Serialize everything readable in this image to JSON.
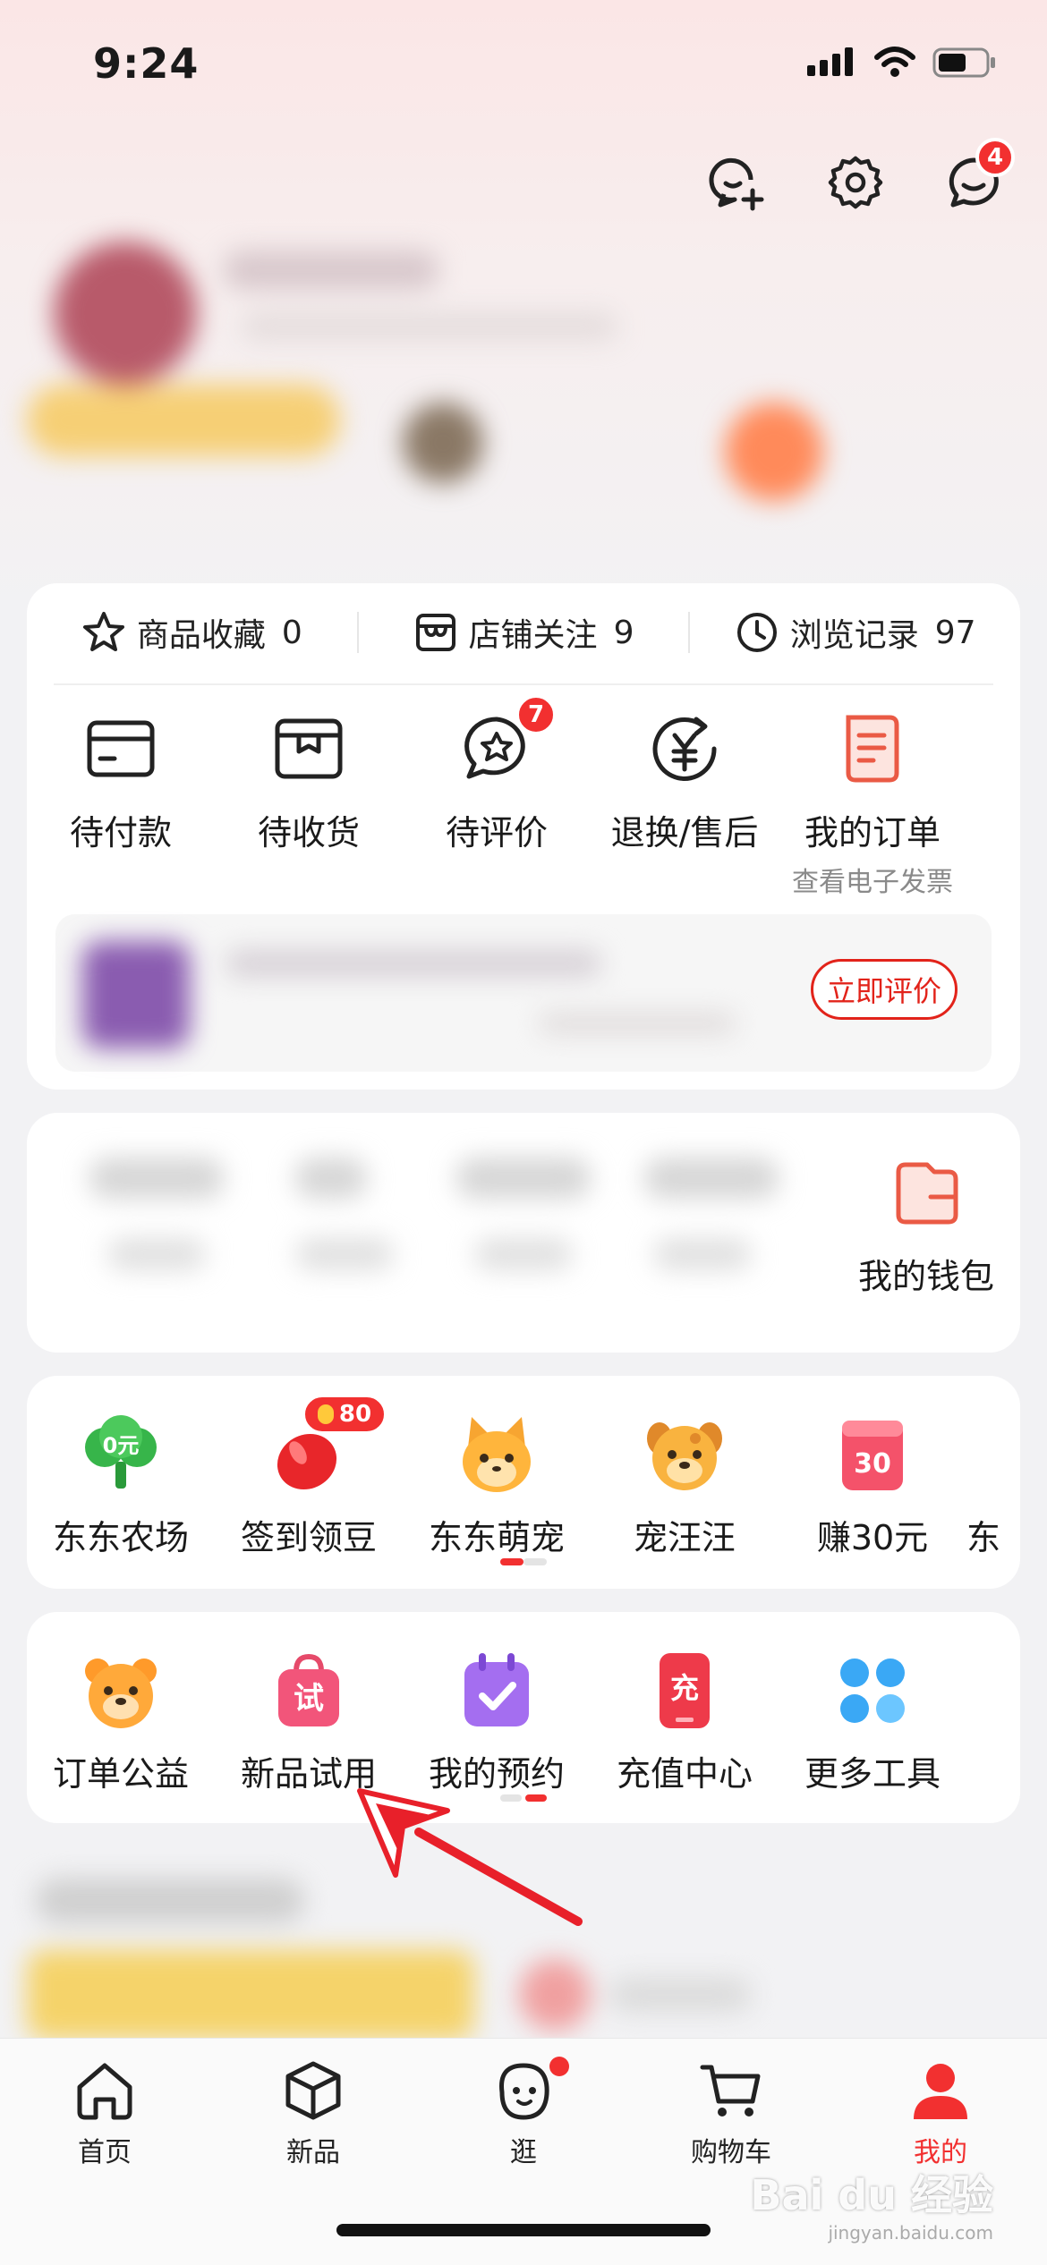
{
  "status_bar": {
    "time": "9:24"
  },
  "header": {
    "message_badge": "4"
  },
  "stats": [
    {
      "label": "商品收藏",
      "value": "0",
      "icon": "star-icon"
    },
    {
      "label": "店铺关注",
      "value": "9",
      "icon": "store-icon"
    },
    {
      "label": "浏览记录",
      "value": "97",
      "icon": "clock-icon"
    }
  ],
  "orders": {
    "items": [
      {
        "label": "待付款",
        "icon": "card-icon"
      },
      {
        "label": "待收货",
        "icon": "box-icon"
      },
      {
        "label": "待评价",
        "icon": "review-icon",
        "badge": "7"
      },
      {
        "label": "退换/售后",
        "icon": "refund-icon"
      },
      {
        "label": "我的订单",
        "sub": "查看电子发票",
        "icon": "order-doc-icon"
      }
    ],
    "review_button": "立即评价"
  },
  "wallet": {
    "label": "我的钱包",
    "icon": "wallet-icon"
  },
  "games": {
    "items": [
      {
        "label": "东东农场",
        "icon_text": "0元",
        "icon": "farm-tree-icon"
      },
      {
        "label": "签到领豆",
        "icon": "bean-icon",
        "badge": "80"
      },
      {
        "label": "东东萌宠",
        "icon": "cute-pet-icon"
      },
      {
        "label": "宠汪汪",
        "icon": "dog-icon"
      },
      {
        "label": "赚30元",
        "icon_text": "30",
        "icon": "calendar-30-icon"
      },
      {
        "label": "东"
      }
    ]
  },
  "tools": {
    "items": [
      {
        "label": "订单公益",
        "icon": "bear-icon"
      },
      {
        "label": "新品试用",
        "icon_text": "试",
        "icon": "trial-bag-icon"
      },
      {
        "label": "我的预约",
        "icon": "calendar-check-icon"
      },
      {
        "label": "充值中心",
        "icon_text": "充",
        "icon": "recharge-phone-icon"
      },
      {
        "label": "更多工具",
        "icon": "four-dots-icon"
      }
    ]
  },
  "tabbar": [
    {
      "label": "首页",
      "icon": "home-icon"
    },
    {
      "label": "新品",
      "icon": "cube-icon"
    },
    {
      "label": "逛",
      "icon": "face-icon"
    },
    {
      "label": "购物车",
      "icon": "cart-icon"
    },
    {
      "label": "我的",
      "icon": "person-icon"
    }
  ],
  "watermark": {
    "brand": "Bai du 经验",
    "url": "jingyan.baidu.com"
  },
  "colors": {
    "accent": "#f23030",
    "brand_red": "#e2231a"
  }
}
